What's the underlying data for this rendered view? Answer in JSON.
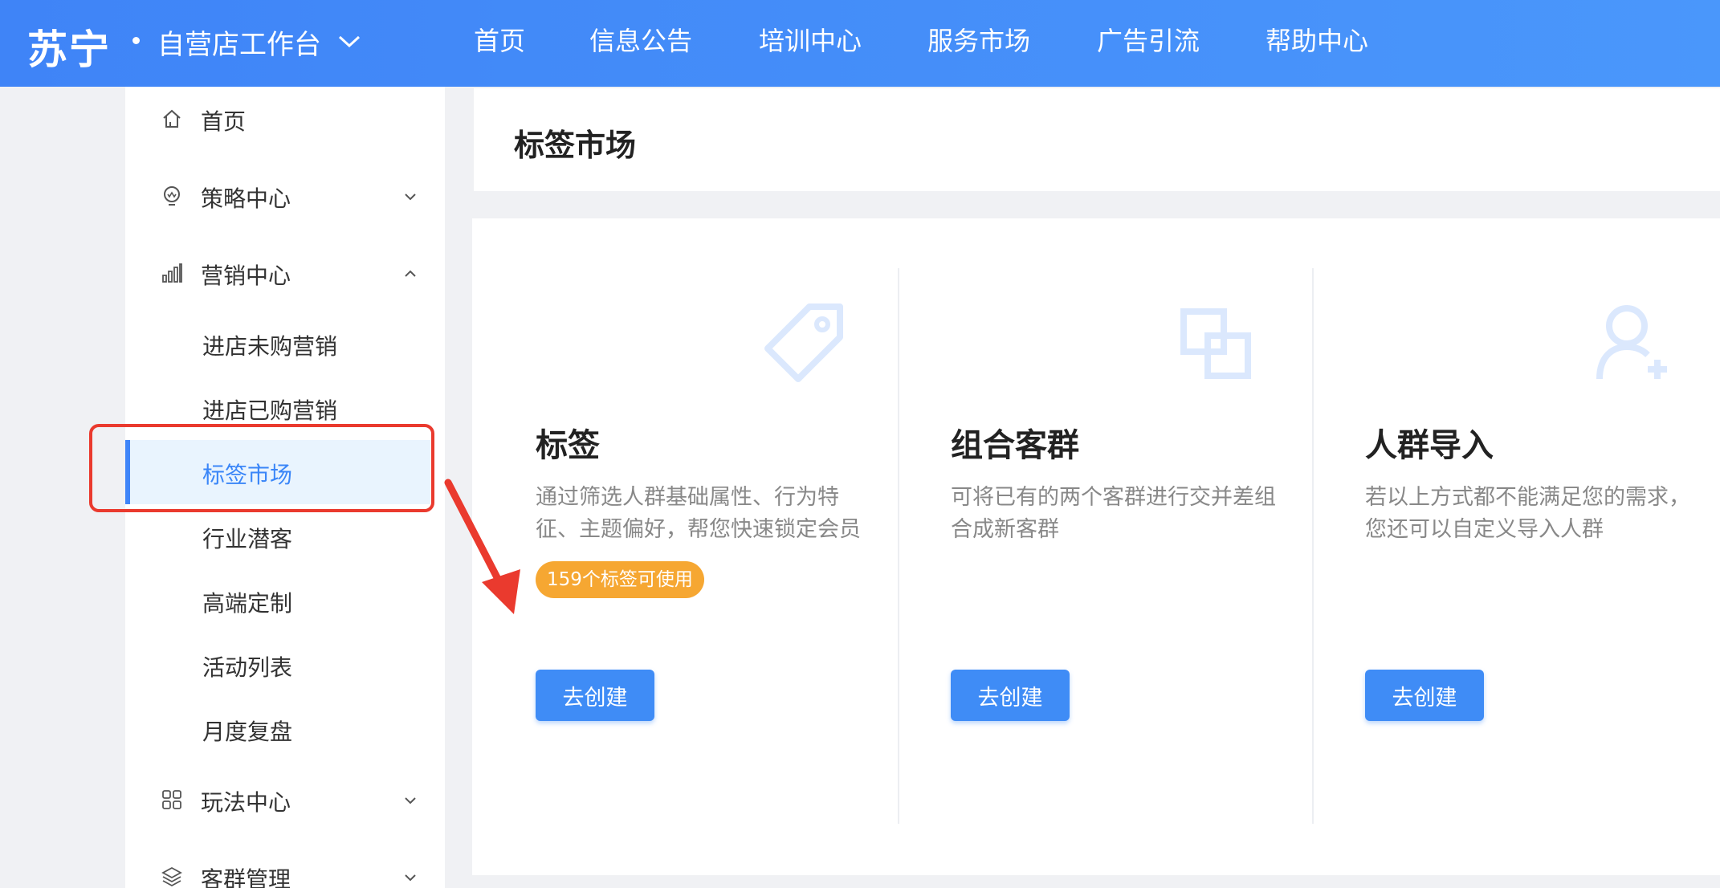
{
  "header": {
    "logo": "苏宁",
    "workspace": "自营店工作台",
    "nav": [
      "首页",
      "信息公告",
      "培训中心",
      "服务市场",
      "广告引流",
      "帮助中心"
    ]
  },
  "sidebar": {
    "home": "首页",
    "strategy": "策略中心",
    "marketing": "营销中心",
    "marketing_items": [
      "进店未购营销",
      "进店已购营销",
      "标签市场",
      "行业潜客",
      "高端定制",
      "活动列表",
      "月度复盘"
    ],
    "active_item": "标签市场",
    "play": "玩法中心",
    "crowd": "客群管理"
  },
  "page": {
    "title": "标签市场"
  },
  "cards": [
    {
      "title": "标签",
      "desc": "通过筛选人群基础属性、行为特征、主题偏好，帮您快速锁定会员",
      "badge": "159个标签可使用",
      "button": "去创建",
      "icon": "tag-icon"
    },
    {
      "title": "组合客群",
      "desc": "可将已有的两个客群进行交并差组合成新客群",
      "button": "去创建",
      "icon": "combine-squares-icon"
    },
    {
      "title": "人群导入",
      "desc": "若以上方式都不能满足您的需求，您还可以自定义导入人群",
      "button": "去创建",
      "icon": "user-add-icon"
    }
  ],
  "colors": {
    "primary": "#3f8cf6",
    "header": "#4a8ff8",
    "badge": "#f6a732",
    "annotation": "#ea3a2e",
    "active_bg": "#e9f4fe"
  }
}
